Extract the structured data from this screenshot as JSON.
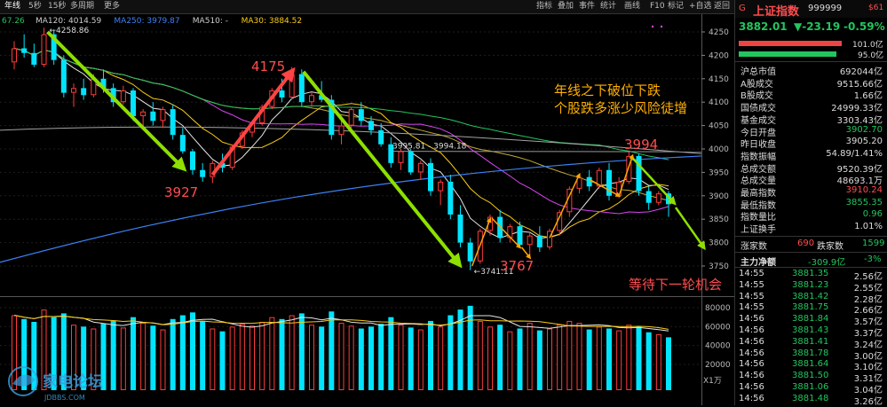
{
  "toolbar": {
    "left_tabs": [
      "年线",
      "5秒",
      "15秒",
      "多周期",
      "更多"
    ],
    "right_tabs": [
      "指标",
      "叠加",
      "事件",
      "统计",
      "画线",
      "F10",
      "标记",
      "+自选",
      "返回"
    ]
  },
  "ma_legend": [
    {
      "label": "67.26",
      "color": "#22c55e"
    },
    {
      "label": "MA120: 4014.59",
      "color": "#cccccc"
    },
    {
      "label": "MA250: 3979.87",
      "color": "#3b82f6"
    },
    {
      "label": "MA510: -",
      "color": "#cccccc"
    },
    {
      "label": "MA30: 3884.52",
      "color": "#facc15"
    }
  ],
  "price_axis": [
    "4250",
    "4200",
    "4150",
    "4100",
    "4050",
    "4000",
    "3950",
    "3900",
    "3850",
    "3800",
    "3750"
  ],
  "volume_axis": [
    "80000",
    "60000",
    "40000",
    "20000"
  ],
  "volume_unit": "X1万",
  "chart_labels": {
    "high_marker": "4258.86",
    "low_marker": "3741.11",
    "range_label": "3995.81 - 3994.18",
    "label_4175": "4175",
    "label_3927": "3927",
    "label_3767": "3767",
    "label_3994": "3994",
    "comment_line1": "年线之下破位下跌",
    "comment_line2": "个股跌多涨少风险徒增",
    "comment_wait": "等待下一轮机会",
    "watermark_main": "家电论坛",
    "watermark_sub": "JDBBS.COM"
  },
  "quote_header": {
    "flag": "G",
    "name": "上证指数",
    "code": "999999",
    "tag": "$61",
    "price": "3882.01",
    "change": "▼-23.19",
    "change_pct": "-0.59%",
    "bar1_value": "101.0亿",
    "bar2_value": "95.0亿"
  },
  "stats": [
    {
      "label": "沪总市值",
      "value": "692044亿",
      "color": "#dddddd"
    },
    {
      "label": "A股成交",
      "value": "9515.66亿",
      "color": "#dddddd"
    },
    {
      "label": "B股成交",
      "value": "1.66亿",
      "color": "#dddddd"
    },
    {
      "label": "国债成交",
      "value": "24999.33亿",
      "color": "#dddddd"
    },
    {
      "label": "基金成交",
      "value": "3303.43亿",
      "color": "#dddddd"
    },
    {
      "label": "今日开盘",
      "value": "3902.70",
      "color": "#22c55e"
    },
    {
      "label": "昨日收盘",
      "value": "3905.20",
      "color": "#dddddd"
    },
    {
      "label": "指数振幅",
      "value": "54.89/1.41%",
      "color": "#dddddd"
    },
    {
      "label": "总成交额",
      "value": "9520.39亿",
      "color": "#dddddd"
    },
    {
      "label": "总成交量",
      "value": "48693.1万",
      "color": "#dddddd"
    },
    {
      "label": "最高指数",
      "value": "3910.24",
      "color": "#ff4d4f"
    },
    {
      "label": "最低指数",
      "value": "3855.35",
      "color": "#22c55e"
    },
    {
      "label": "指数量比",
      "value": "0.96",
      "color": "#22c55e"
    },
    {
      "label": "上证换手",
      "value": "1.01%",
      "color": "#dddddd"
    }
  ],
  "breadth": {
    "up_label": "涨家数",
    "up_value": "690",
    "down_label": "跌家数",
    "down_value": "1599"
  },
  "flow": {
    "label": "主力净额",
    "value": "-309.9亿",
    "pct": "-3%"
  },
  "ticks": [
    {
      "time": "14:55",
      "price": "3881.35",
      "amount": "2.56亿"
    },
    {
      "time": "14:55",
      "price": "3881.23",
      "amount": "2.55亿"
    },
    {
      "time": "14:55",
      "price": "3881.42",
      "amount": "2.28亿"
    },
    {
      "time": "14:55",
      "price": "3881.75",
      "amount": "2.66亿"
    },
    {
      "time": "14:56",
      "price": "3881.84",
      "amount": "3.57亿"
    },
    {
      "time": "14:56",
      "price": "3881.43",
      "amount": "3.37亿"
    },
    {
      "time": "14:56",
      "price": "3881.41",
      "amount": "3.24亿"
    },
    {
      "time": "14:56",
      "price": "3881.78",
      "amount": "3.00亿"
    },
    {
      "time": "14:56",
      "price": "3881.64",
      "amount": "3.10亿"
    },
    {
      "time": "14:56",
      "price": "3881.50",
      "amount": "3.31亿"
    },
    {
      "time": "14:56",
      "price": "3881.06",
      "amount": "3.04亿"
    },
    {
      "time": "14:56",
      "price": "3881.48",
      "amount": "3.26亿"
    }
  ],
  "chart_data": {
    "type": "bar",
    "candles_ohlc": [
      [
        4185,
        4230,
        4170,
        4215
      ],
      [
        4215,
        4245,
        4195,
        4205
      ],
      [
        4205,
        4225,
        4175,
        4180
      ],
      [
        4180,
        4259,
        4175,
        4245
      ],
      [
        4245,
        4255,
        4180,
        4190
      ],
      [
        4190,
        4200,
        4110,
        4120
      ],
      [
        4120,
        4140,
        4090,
        4130
      ],
      [
        4130,
        4150,
        4105,
        4115
      ],
      [
        4115,
        4160,
        4110,
        4150
      ],
      [
        4150,
        4170,
        4120,
        4130
      ],
      [
        4130,
        4140,
        4090,
        4100
      ],
      [
        4100,
        4135,
        4095,
        4125
      ],
      [
        4125,
        4130,
        4060,
        4070
      ],
      [
        4070,
        4085,
        4040,
        4080
      ],
      [
        4080,
        4100,
        4050,
        4060
      ],
      [
        4060,
        4090,
        4045,
        4085
      ],
      [
        4085,
        4095,
        4020,
        4030
      ],
      [
        4030,
        4045,
        3990,
        3995
      ],
      [
        3995,
        4000,
        3945,
        3955
      ],
      [
        3955,
        3970,
        3930,
        3940
      ],
      [
        3940,
        3975,
        3927,
        3970
      ],
      [
        3970,
        3990,
        3950,
        3960
      ],
      [
        3960,
        4010,
        3955,
        4005
      ],
      [
        4005,
        4040,
        4000,
        4035
      ],
      [
        4035,
        4060,
        4025,
        4055
      ],
      [
        4055,
        4095,
        4050,
        4090
      ],
      [
        4090,
        4130,
        4085,
        4125
      ],
      [
        4125,
        4150,
        4100,
        4110
      ],
      [
        4110,
        4175,
        4105,
        4160
      ],
      [
        4160,
        4170,
        4090,
        4100
      ],
      [
        4100,
        4120,
        4090,
        4115
      ],
      [
        4115,
        4145,
        4100,
        4105
      ],
      [
        4105,
        4115,
        4020,
        4030
      ],
      [
        4030,
        4060,
        4010,
        4050
      ],
      [
        4050,
        4090,
        4045,
        4085
      ],
      [
        4085,
        4100,
        4050,
        4060
      ],
      [
        4060,
        4070,
        4030,
        4040
      ],
      [
        4040,
        4055,
        4005,
        4010
      ],
      [
        4010,
        4025,
        3960,
        3970
      ],
      [
        3970,
        4000,
        3955,
        3995
      ],
      [
        3995,
        4000,
        3945,
        3950
      ],
      [
        3950,
        3975,
        3935,
        3970
      ],
      [
        3970,
        3980,
        3900,
        3910
      ],
      [
        3910,
        3935,
        3880,
        3930
      ],
      [
        3930,
        3945,
        3850,
        3860
      ],
      [
        3860,
        3880,
        3790,
        3800
      ],
      [
        3800,
        3810,
        3741,
        3760
      ],
      [
        3760,
        3830,
        3755,
        3825
      ],
      [
        3825,
        3860,
        3815,
        3855
      ],
      [
        3855,
        3870,
        3800,
        3810
      ],
      [
        3810,
        3840,
        3800,
        3835
      ],
      [
        3835,
        3845,
        3790,
        3795
      ],
      [
        3795,
        3820,
        3767,
        3815
      ],
      [
        3815,
        3835,
        3780,
        3790
      ],
      [
        3790,
        3830,
        3785,
        3825
      ],
      [
        3825,
        3870,
        3815,
        3865
      ],
      [
        3865,
        3920,
        3855,
        3915
      ],
      [
        3915,
        3945,
        3905,
        3940
      ],
      [
        3940,
        3955,
        3910,
        3920
      ],
      [
        3920,
        3960,
        3915,
        3955
      ],
      [
        3955,
        3970,
        3890,
        3900
      ],
      [
        3900,
        3940,
        3895,
        3930
      ],
      [
        3930,
        3994,
        3925,
        3985
      ],
      [
        3985,
        3990,
        3900,
        3910
      ],
      [
        3910,
        3920,
        3870,
        3885
      ],
      [
        3885,
        3910,
        3880,
        3905
      ],
      [
        3905,
        3910,
        3855,
        3882
      ]
    ],
    "volumes": [
      72000,
      68000,
      65000,
      78000,
      70000,
      74000,
      62000,
      60000,
      58000,
      63000,
      66000,
      59000,
      70000,
      64000,
      61000,
      57000,
      68000,
      72000,
      75000,
      66000,
      58000,
      55000,
      60000,
      63000,
      61000,
      65000,
      70000,
      68000,
      72000,
      74000,
      62000,
      60000,
      76000,
      64000,
      61000,
      58000,
      60000,
      63000,
      70000,
      62000,
      59000,
      57000,
      66000,
      60000,
      72000,
      78000,
      82000,
      66000,
      60000,
      62000,
      55000,
      58000,
      64000,
      56000,
      58000,
      62000,
      66000,
      64000,
      57000,
      60000,
      58000,
      56000,
      62000,
      60000,
      54000,
      52000,
      48700
    ]
  }
}
